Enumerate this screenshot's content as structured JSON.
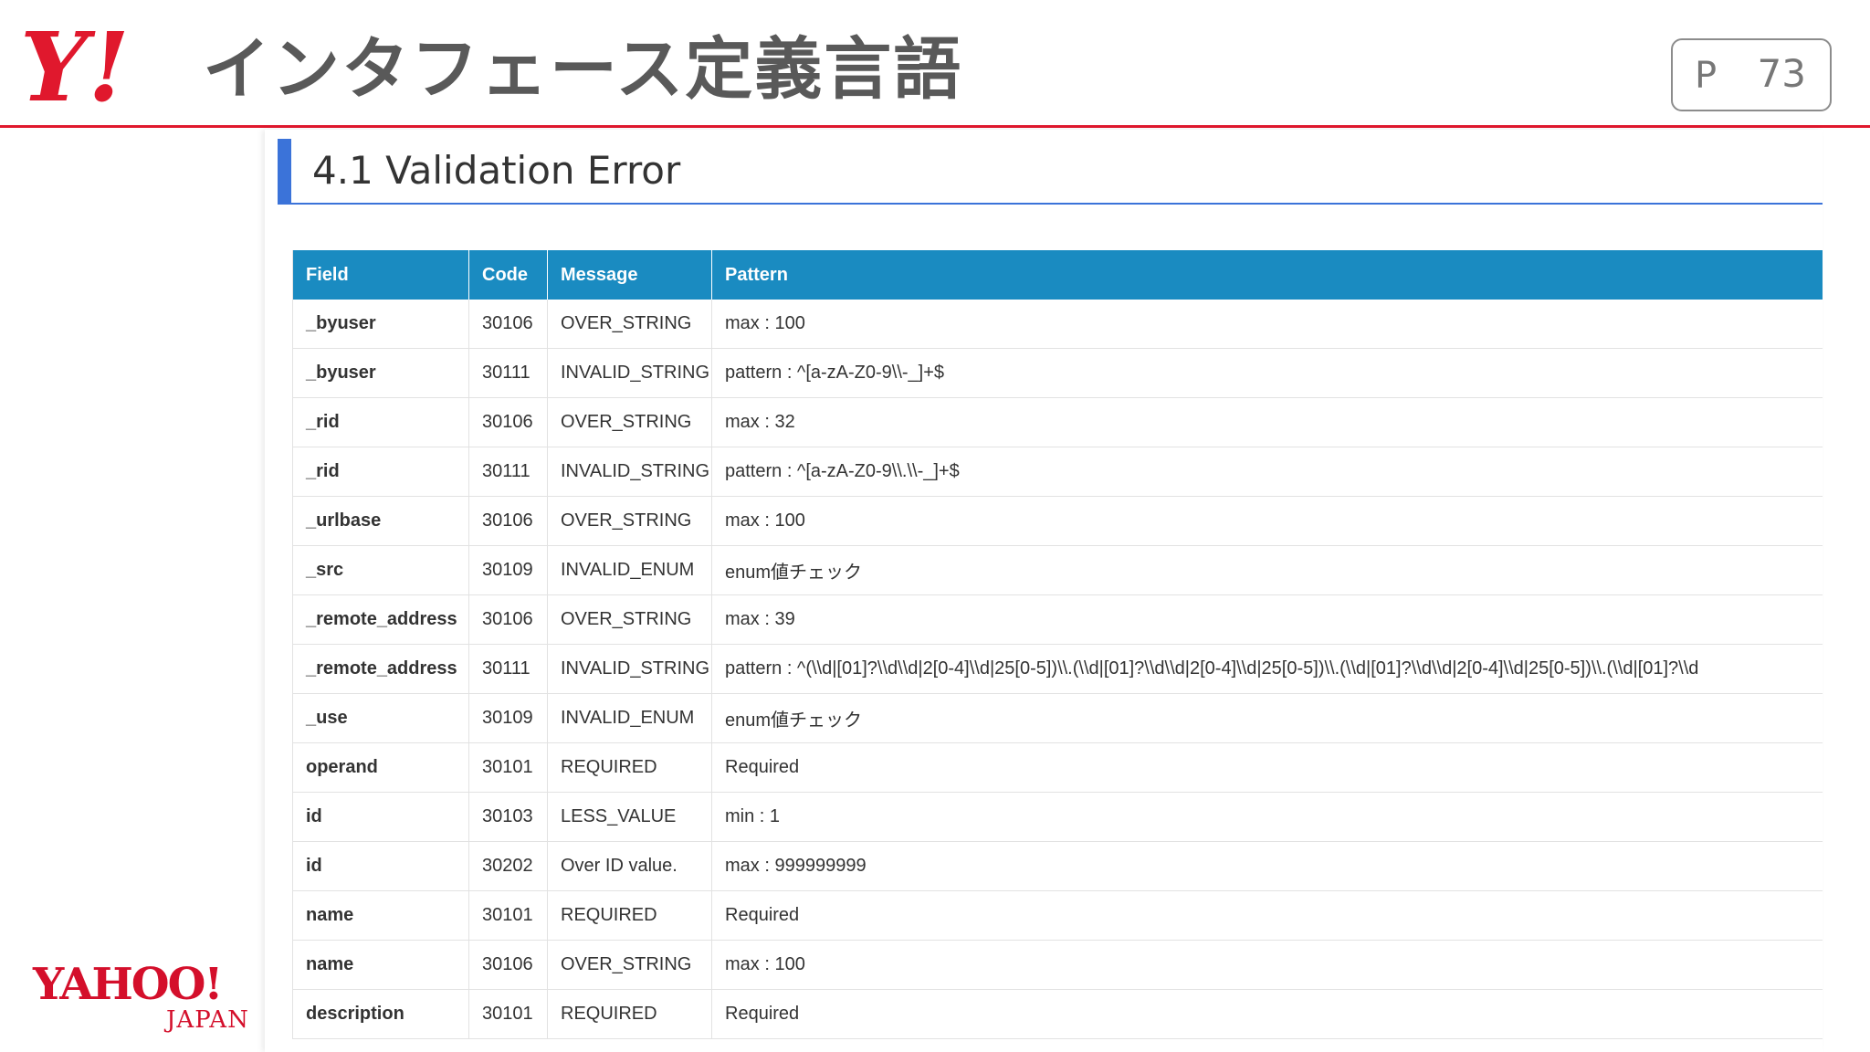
{
  "header": {
    "logo_text": "Y!",
    "title": "インタフェース定義言語",
    "page_label": "P",
    "page_number": "73"
  },
  "section": {
    "heading": "4.1 Validation Error"
  },
  "table": {
    "headers": [
      "Field",
      "Code",
      "Message",
      "Pattern"
    ],
    "rows": [
      [
        "_byuser",
        "30106",
        "OVER_STRING",
        "max : 100"
      ],
      [
        "_byuser",
        "30111",
        "INVALID_STRING",
        "pattern : ^[a-zA-Z0-9\\\\-_]+$"
      ],
      [
        "_rid",
        "30106",
        "OVER_STRING",
        "max : 32"
      ],
      [
        "_rid",
        "30111",
        "INVALID_STRING",
        "pattern : ^[a-zA-Z0-9\\\\.\\\\-_]+$"
      ],
      [
        "_urlbase",
        "30106",
        "OVER_STRING",
        "max : 100"
      ],
      [
        "_src",
        "30109",
        "INVALID_ENUM",
        "enum値チェック"
      ],
      [
        "_remote_address",
        "30106",
        "OVER_STRING",
        "max : 39"
      ],
      [
        "_remote_address",
        "30111",
        "INVALID_STRING",
        "pattern : ^(\\\\d|[01]?\\\\d\\\\d|2[0-4]\\\\d|25[0-5])\\\\.(\\\\d|[01]?\\\\d\\\\d|2[0-4]\\\\d|25[0-5])\\\\.(\\\\d|[01]?\\\\d\\\\d|2[0-4]\\\\d|25[0-5])\\\\.(\\\\d|[01]?\\\\d"
      ],
      [
        "_use",
        "30109",
        "INVALID_ENUM",
        "enum値チェック"
      ],
      [
        "operand",
        "30101",
        "REQUIRED",
        "Required"
      ],
      [
        "id",
        "30103",
        "LESS_VALUE",
        "min : 1"
      ],
      [
        "id",
        "30202",
        "Over ID value.",
        "max : 999999999"
      ],
      [
        "name",
        "30101",
        "REQUIRED",
        "Required"
      ],
      [
        "name",
        "30106",
        "OVER_STRING",
        "max : 100"
      ],
      [
        "description",
        "30101",
        "REQUIRED",
        "Required"
      ]
    ]
  },
  "footer": {
    "logo_main": "YAHOO!",
    "logo_sub": "JAPAN"
  },
  "colors": {
    "brand_red": "#e0182d",
    "table_header": "#1a8bc1",
    "heading_accent": "#3b73d9"
  }
}
